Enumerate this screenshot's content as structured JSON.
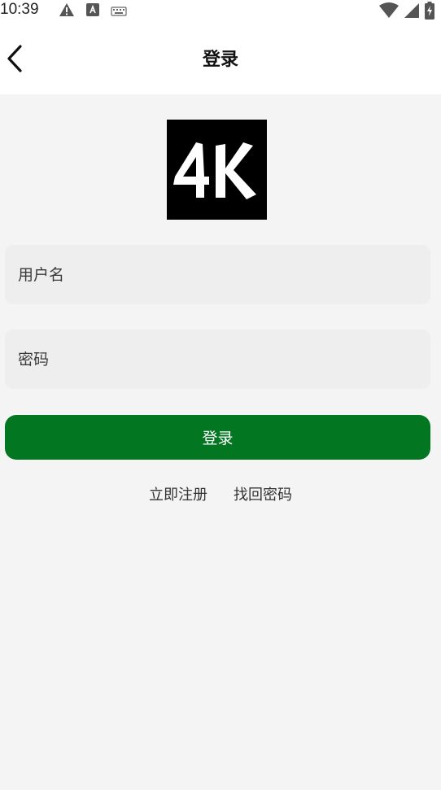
{
  "status_bar": {
    "time": "10:39",
    "icons_left": [
      "warning-icon",
      "font-app-icon",
      "keyboard-icon"
    ],
    "icons_right": [
      "wifi-icon",
      "signal-icon",
      "battery-charging-icon"
    ]
  },
  "app_bar": {
    "back_icon": "chevron-left-icon",
    "title": "登录"
  },
  "logo": {
    "text": "4K"
  },
  "form": {
    "username_placeholder": "用户名",
    "password_placeholder": "密码",
    "login_label": "登录"
  },
  "links": {
    "register": "立即注册",
    "recover": "找回密码"
  },
  "colors": {
    "primary": "#037622",
    "background": "#f4f4f4",
    "input_bg": "#eeeeee"
  }
}
